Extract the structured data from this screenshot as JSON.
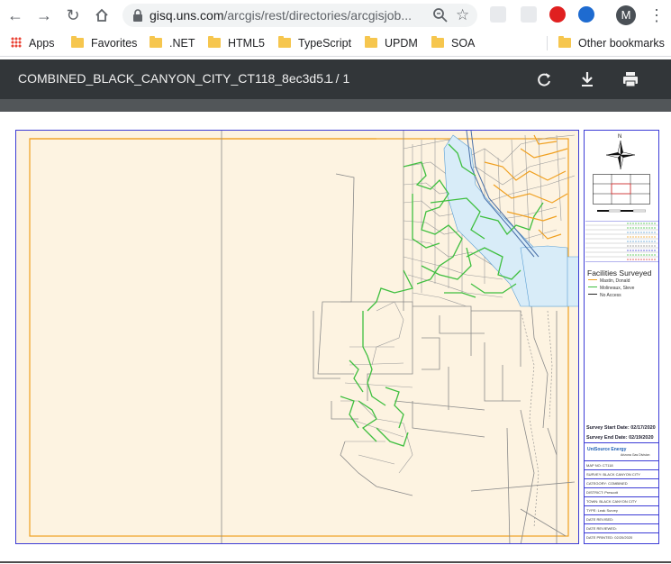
{
  "browser": {
    "url_host": "gisq.uns.com",
    "url_path": "/arcgis/rest/directories/arcgisjob...",
    "avatar_letter": "M"
  },
  "bookmarks": [
    {
      "label": "Apps",
      "icon": "apps-grid-icon"
    },
    {
      "label": "Favorites",
      "icon": "folder-icon"
    },
    {
      "label": ".NET",
      "icon": "folder-icon"
    },
    {
      "label": "HTML5",
      "icon": "folder-icon"
    },
    {
      "label": "TypeScript",
      "icon": "folder-icon"
    },
    {
      "label": "UPDM",
      "icon": "folder-icon"
    },
    {
      "label": "SOA",
      "icon": "folder-icon"
    },
    {
      "label": "Other bookmarks",
      "icon": "folder-icon"
    }
  ],
  "pdf": {
    "title": "COMBINED_BLACK_CANYON_CITY_CT118_8ec3d5...",
    "page_indicator": "1 / 1"
  },
  "legend": {
    "north": "N",
    "facilities_title": "Facilities Surveyed",
    "surveyors": [
      {
        "name": "Mastin, Donald",
        "color": "#f0a020"
      },
      {
        "name": "Molineaux, Steve",
        "color": "#3fbf3f"
      },
      {
        "name": "No Access",
        "color": "#222222"
      }
    ],
    "survey_start_label": "Survey Start Date:",
    "survey_start": "02/17/2020",
    "survey_end_label": "Survey End Date:",
    "survey_end": "02/19/2020",
    "logo_text": "UniSource Energy",
    "division": "Arizona Gas Division",
    "title_block": [
      "MAP NO: CT118",
      "SURVEY: BLACK CANYON CITY",
      "CATEGORY: COMBINED",
      "DISTRICT: Prescott",
      "TOWN: BLACK CANYON CITY",
      "TYPE: Leak Survey",
      "DATE REVISED:",
      "DATE REVIEWED:",
      "DATE PRINTED: 02/20/2020"
    ]
  },
  "colors": {
    "parcel_fill": "#fdf3e1",
    "boundary_orange": "#f0a020",
    "survey_green": "#3fbf3f",
    "water_blue": "#d8ecf8",
    "frame_blue": "#3c3cd6"
  }
}
